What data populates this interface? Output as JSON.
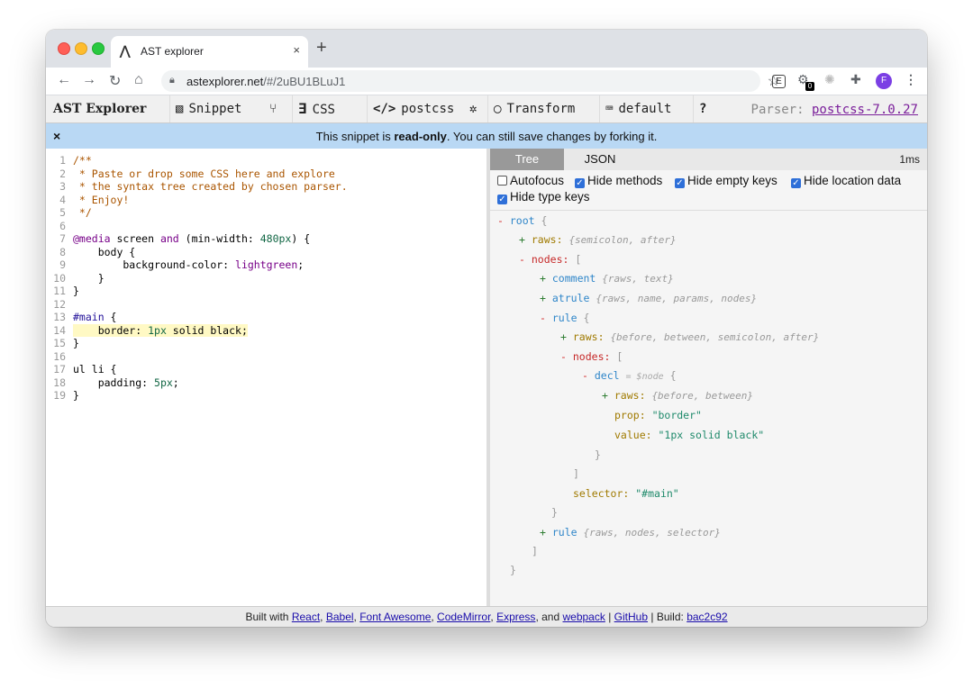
{
  "browser": {
    "tab_title": "AST explorer",
    "tab_close": "×",
    "new_tab": "+",
    "url_host": "astexplorer.net",
    "url_path": "/#/2uBU1BLuJ1",
    "extension_badge": "0",
    "profile_initial": "F"
  },
  "toolbar": {
    "brand": "AST Explorer",
    "snippet": "Snippet",
    "language": "CSS",
    "parser_name": "postcss",
    "transform": "Transform",
    "keymap": "default",
    "help": "?",
    "parser_label": "Parser:",
    "parser_version": "postcss-7.0.27"
  },
  "banner": {
    "close": "×",
    "msg_before": "This snippet is ",
    "msg_bold": "read-only",
    "msg_after": ". You can still save changes by forking it."
  },
  "editor": {
    "lines": [
      "/**",
      " * Paste or drop some CSS here and explore",
      " * the syntax tree created by chosen parser.",
      " * Enjoy!",
      " */",
      "",
      "@media screen and (min-width: 480px) {",
      "    body {",
      "        background-color: lightgreen;",
      "    }",
      "}",
      "",
      "#main {",
      "    border: 1px solid black;",
      "}",
      "",
      "ul li {",
      "    padding: 5px;",
      "}"
    ],
    "highlighted_line": 14
  },
  "ast_panel": {
    "tabs": [
      "Tree",
      "JSON"
    ],
    "active_tab": "Tree",
    "timing": "1ms",
    "options": [
      {
        "label": "Autofocus",
        "checked": false
      },
      {
        "label": "Hide methods",
        "checked": true
      },
      {
        "label": "Hide empty keys",
        "checked": true
      },
      {
        "label": "Hide location data",
        "checked": true
      },
      {
        "label": "Hide type keys",
        "checked": true
      }
    ],
    "tree": {
      "root": "root",
      "root_raws_key": "raws:",
      "root_raws_summary": "{semicolon, after}",
      "nodes_key": "nodes:",
      "comment_type": "comment",
      "comment_summary": "{raws, text}",
      "atrule_type": "atrule",
      "atrule_summary": "{raws, name, params, nodes}",
      "rule_type": "rule",
      "rule_raws_key": "raws:",
      "rule_raws_summary": "{before, between, semicolon, after}",
      "rule_nodes_key": "nodes:",
      "decl_type": "decl",
      "decl_note": "= $node",
      "decl_raws_key": "raws:",
      "decl_raws_summary": "{before, between}",
      "prop_key": "prop:",
      "prop_value": "\"border\"",
      "value_key": "value:",
      "value_value": "\"1px solid black\"",
      "selector_key": "selector:",
      "selector_value": "\"#main\"",
      "rule2_type": "rule",
      "rule2_summary": "{raws, nodes, selector}"
    }
  },
  "footer": {
    "built_with": "Built with",
    "links": [
      "React",
      "Babel",
      "Font Awesome",
      "CodeMirror",
      "Express",
      "webpack",
      "GitHub",
      "bac2c92"
    ],
    "and": "and",
    "build_label": "Build:"
  },
  "colors": {
    "banner_bg": "#b9d8f4",
    "tab_active_bg": "#999999",
    "checkbox_blue": "#2e6fd8",
    "parser_link": "#7a1e9a"
  },
  "icons": [
    "back-icon",
    "forward-icon",
    "reload-icon",
    "home-icon",
    "lock-icon",
    "star-icon",
    "puzzle-icon",
    "more-icon",
    "snippet-icon",
    "fork-icon",
    "css3-icon",
    "code-icon",
    "gear-icon",
    "toggle-icon",
    "keyboard-icon",
    "close-icon"
  ]
}
